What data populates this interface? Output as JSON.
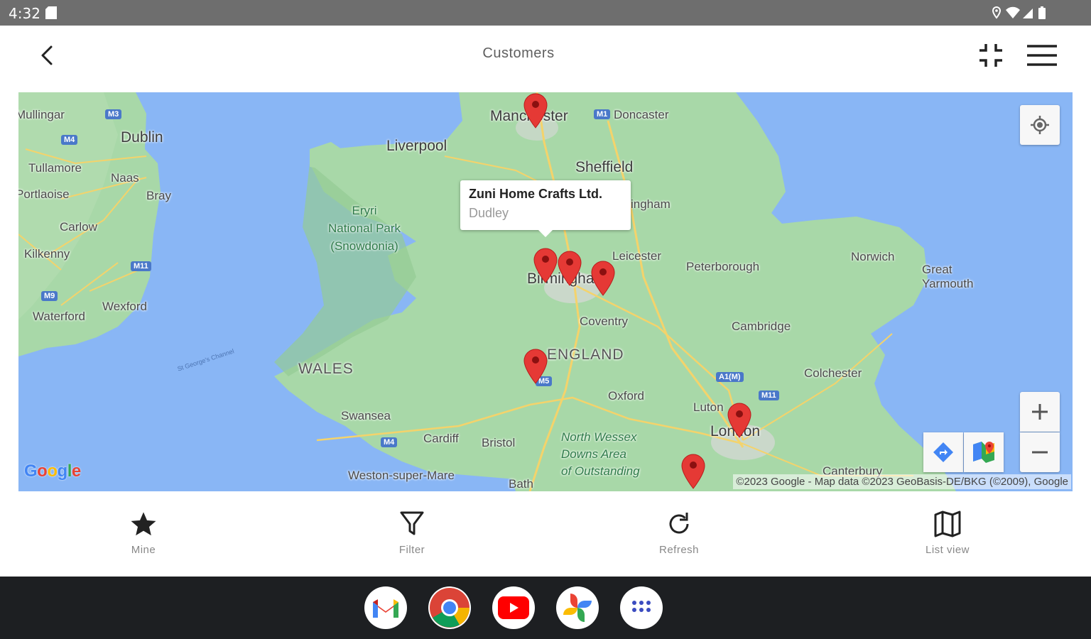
{
  "status_bar": {
    "time": "4:32"
  },
  "app_bar": {
    "title": "Customers"
  },
  "map": {
    "callout": {
      "name": "Zuni Home Crafts Ltd.",
      "city": "Dudley"
    },
    "attribution": "©2023 Google - Map data ©2023 GeoBasis-DE/BKG (©2009), Google",
    "logo": "Google",
    "labels": {
      "mullingar": "Mullingar",
      "dublin": "Dublin",
      "tullamore": "Tullamore",
      "naas": "Naas",
      "bray": "Bray",
      "portlaoise": "Portlaoise",
      "carlow": "Carlow",
      "kilkenny": "Kilkenny",
      "wexford": "Wexford",
      "waterford": "Waterford",
      "liverpool": "Liverpool",
      "manchester": "Manchester",
      "doncaster": "Doncaster",
      "sheffield": "Sheffield",
      "nottingham": "ingham",
      "eryri": "Eryri\nNational Park\n(Snowdonia)",
      "leicester": "Leicester",
      "birmingham": "Birmingham",
      "coventry": "Coventry",
      "peterborough": "Peterborough",
      "norwich": "Norwich",
      "great_yarmouth": "Great\nYarmouth",
      "cambridge": "Cambridge",
      "england": "ENGLAND",
      "wales": "WALES",
      "colchester": "Colchester",
      "oxford": "Oxford",
      "luton": "Luton",
      "london": "London",
      "swansea": "Swansea",
      "cardiff": "Cardiff",
      "bristol": "Bristol",
      "north_wessex": "North Wessex\nDowns Area\nof Outstanding",
      "weston": "Weston-super-Mare",
      "bath": "Bath",
      "canterbury": "Canterbury",
      "st_georges": "St George's Channel"
    },
    "shields": [
      "M3",
      "M4",
      "M11",
      "M9",
      "M1",
      "M5",
      "A1(M)",
      "M11",
      "M4"
    ]
  },
  "bottom_nav": [
    {
      "label": "Mine",
      "icon": "star-icon"
    },
    {
      "label": "Filter",
      "icon": "filter-icon"
    },
    {
      "label": "Refresh",
      "icon": "refresh-icon"
    },
    {
      "label": "List view",
      "icon": "map-icon"
    }
  ],
  "dock": [
    "gmail",
    "chrome",
    "youtube",
    "photos",
    "app-drawer"
  ],
  "colors": {
    "pin": "#e53935",
    "water": "#89b6f5",
    "land": "#a8d8a8",
    "accent": "#4285f4"
  }
}
